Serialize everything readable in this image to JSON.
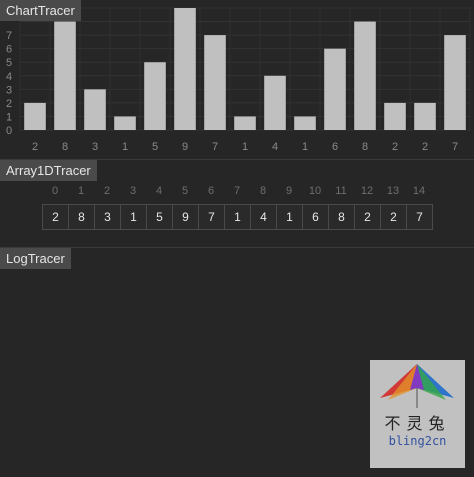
{
  "panels": {
    "chart_tag": "ChartTracer",
    "array_tag": "Array1DTracer",
    "log_tag": "LogTracer"
  },
  "chart_data": {
    "type": "bar",
    "categories": [
      "2",
      "8",
      "3",
      "1",
      "5",
      "9",
      "7",
      "1",
      "4",
      "1",
      "6",
      "8",
      "2",
      "2",
      "7"
    ],
    "values": [
      2,
      8,
      3,
      1,
      5,
      9,
      7,
      1,
      4,
      1,
      6,
      8,
      2,
      2,
      7
    ],
    "yticks": [
      "0",
      "1",
      "2",
      "3",
      "4",
      "5",
      "6",
      "7"
    ],
    "ylim": [
      0,
      9
    ],
    "grid": true,
    "bar_color": "#c0c0c0"
  },
  "array": {
    "indices": [
      "0",
      "1",
      "2",
      "3",
      "4",
      "5",
      "6",
      "7",
      "8",
      "9",
      "10",
      "11",
      "12",
      "13",
      "14"
    ],
    "values": [
      "2",
      "8",
      "3",
      "1",
      "5",
      "9",
      "7",
      "1",
      "4",
      "1",
      "6",
      "8",
      "2",
      "2",
      "7"
    ]
  },
  "watermark": {
    "text_cn": "不灵兔",
    "text_en": "bling2cn"
  },
  "colors": {
    "background": "#262626",
    "tag_bg": "#4a4a4a",
    "bar": "#c0c0c0"
  }
}
